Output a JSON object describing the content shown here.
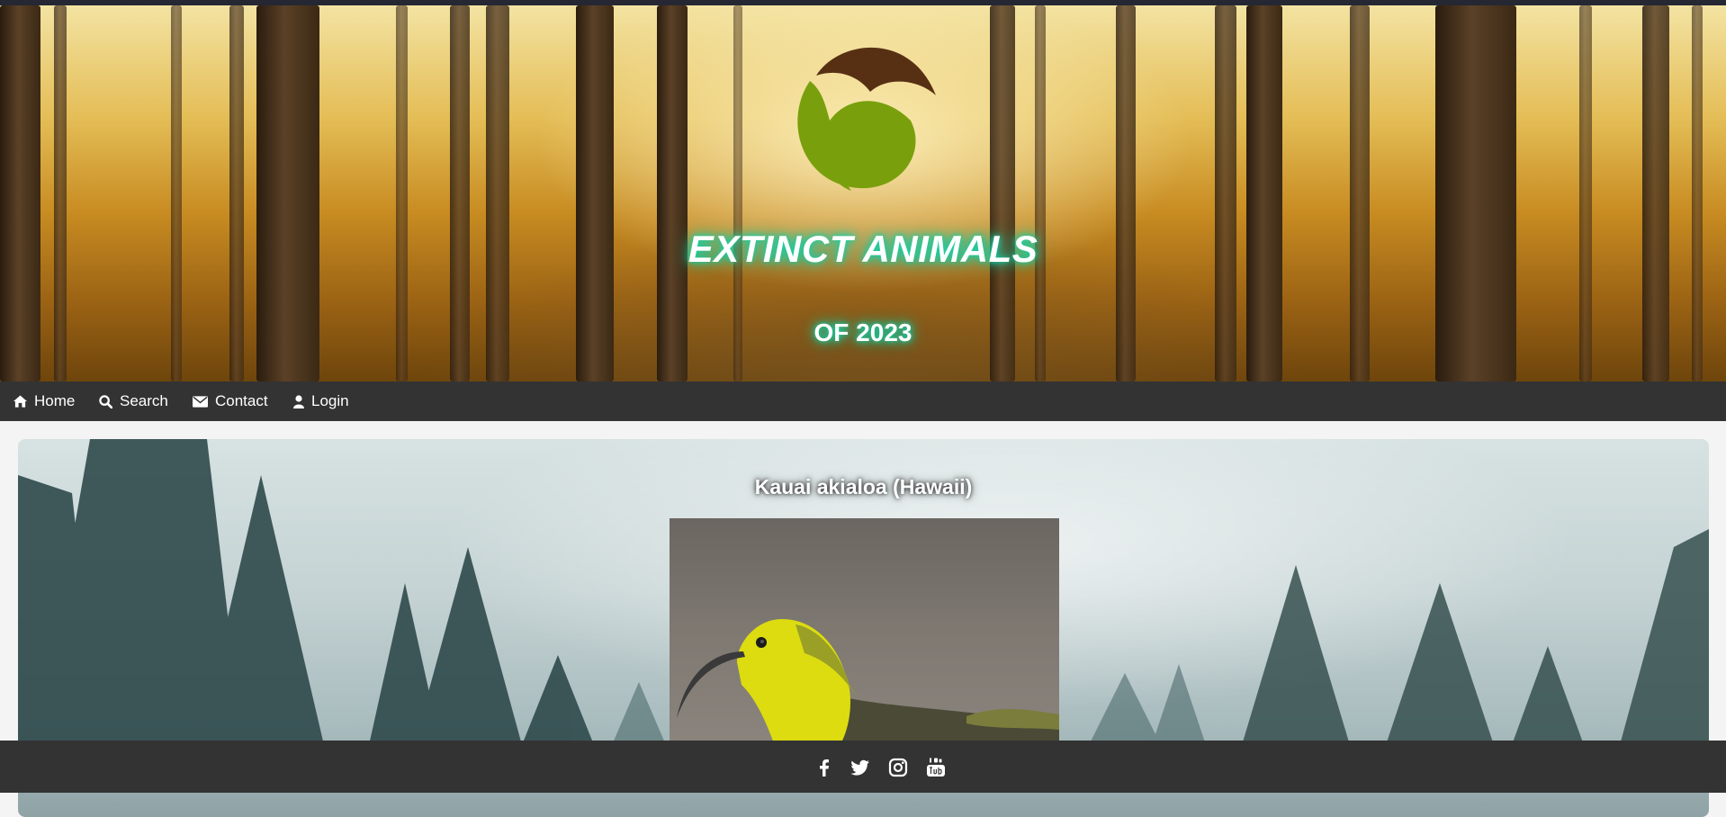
{
  "header": {
    "title": "EXTINCT ANIMALS",
    "subtitle": "OF 2023",
    "logo_icon": "leaf-logo-icon",
    "colors": {
      "glow": "#0fd1a8",
      "logo_green": "#79a00c",
      "logo_brown": "#573014"
    }
  },
  "nav": {
    "items": [
      {
        "label": "Home",
        "icon": "home-icon"
      },
      {
        "label": "Search",
        "icon": "search-icon"
      },
      {
        "label": "Contact",
        "icon": "envelope-icon"
      },
      {
        "label": "Login",
        "icon": "user-icon"
      }
    ],
    "background": "#333333"
  },
  "main": {
    "animal": {
      "name": "Kauai akialoa (Hawaii)"
    }
  },
  "footer": {
    "social": [
      {
        "icon": "facebook-icon"
      },
      {
        "icon": "twitter-icon"
      },
      {
        "icon": "instagram-icon"
      },
      {
        "icon": "youtube-icon"
      }
    ]
  }
}
